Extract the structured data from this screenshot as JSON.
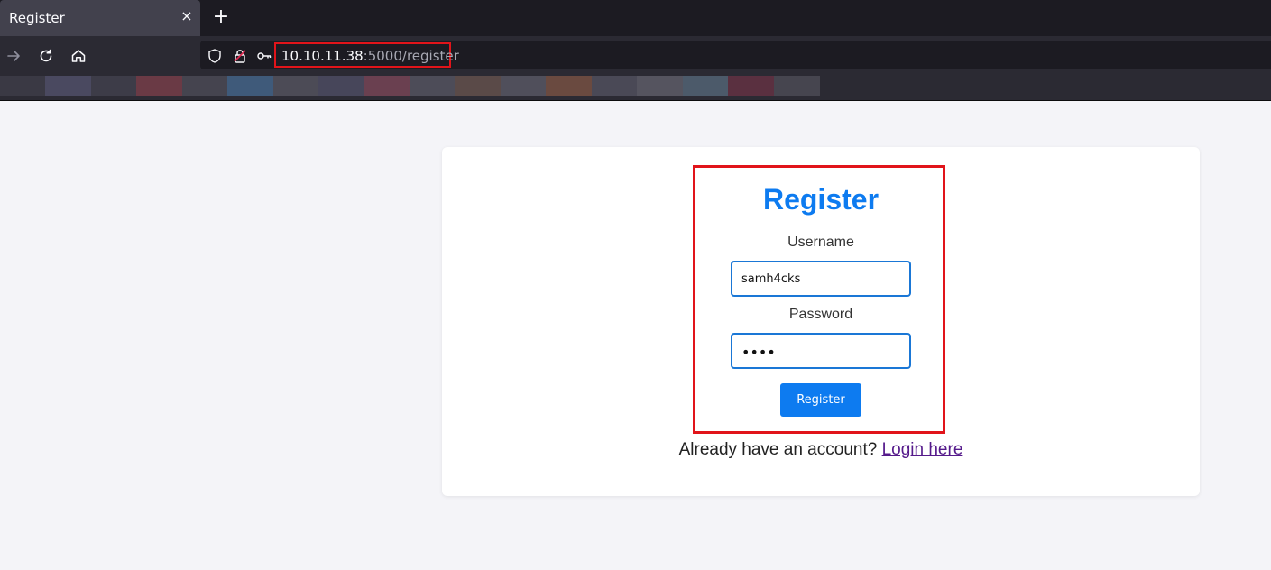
{
  "browser": {
    "tab": {
      "title": "Register",
      "close_glyph": "×"
    },
    "new_tab_glyph": "+",
    "url": {
      "host": "10.10.11.38",
      "rest": ":5000/register"
    },
    "icons": [
      "forward-icon",
      "reload-icon",
      "home-icon",
      "shield-icon",
      "insecure-lock-icon",
      "key-icon",
      "close-icon",
      "plus-icon"
    ],
    "bookmarks_colors": [
      "#3a3944",
      "#4a4960",
      "#3d3c48",
      "#6a3a45",
      "#45444f",
      "#3f5a7a",
      "#4c4b56",
      "#47465a",
      "#6a4050",
      "#4d4c58",
      "#5a4a48",
      "#504f5b",
      "#6a4a40",
      "#4a4956",
      "#55545f",
      "#4c5a6a",
      "#5a3040",
      "#46454f"
    ]
  },
  "page": {
    "title": "Register",
    "username_label": "Username",
    "username_value": "samh4cks",
    "password_label": "Password",
    "password_mask": "••••",
    "submit_label": "Register",
    "login_prompt": "Already have an account?",
    "login_link": "Login here"
  },
  "colors": {
    "accent": "#0d7bf0",
    "highlight": "#e1141a",
    "link": "#551a8b",
    "page_bg": "#f4f4f8"
  }
}
